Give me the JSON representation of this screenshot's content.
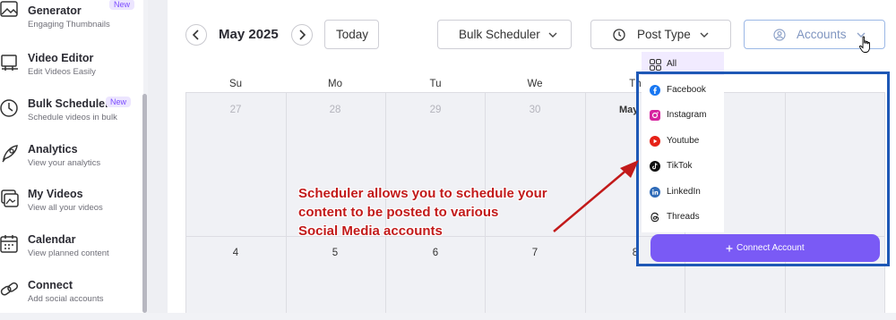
{
  "sidebar": {
    "items": [
      {
        "title": "Generator",
        "subtitle": "Engaging Thumbnails",
        "badge": "New",
        "icon": "image-icon"
      },
      {
        "title": "Video Editor",
        "subtitle": "Edit Videos Easily",
        "icon": "video-editor-icon"
      },
      {
        "title": "Bulk Scheduler",
        "subtitle": "Schedule videos in bulk",
        "badge": "New",
        "icon": "clock-icon"
      },
      {
        "title": "Analytics",
        "subtitle": "View your analytics",
        "icon": "rocket-icon"
      },
      {
        "title": "My Videos",
        "subtitle": "View all your videos",
        "icon": "my-videos-icon"
      },
      {
        "title": "Calendar",
        "subtitle": "View planned content",
        "icon": "calendar-icon"
      },
      {
        "title": "Connect",
        "subtitle": "Add social accounts",
        "icon": "link-icon"
      }
    ]
  },
  "toolbar": {
    "month_label": "May 2025",
    "today_label": "Today",
    "bulk_label": "Bulk Scheduler",
    "post_type_label": "Post Type",
    "accounts_label": "Accounts"
  },
  "calendar": {
    "weekdays": [
      "Su",
      "Mo",
      "Tu",
      "We",
      "Th"
    ],
    "row1": [
      "27",
      "28",
      "29",
      "30"
    ],
    "row1_may": "May",
    "row2": [
      "4",
      "5",
      "6",
      "7",
      "8"
    ]
  },
  "accounts_menu": {
    "items": [
      "All",
      "Facebook",
      "Instagram",
      "Youtube",
      "TikTok",
      "LinkedIn",
      "Threads"
    ],
    "connect_label": "Connect Account"
  },
  "annotation": {
    "lines": [
      "Scheduler allows you to schedule your",
      "content to be posted to various",
      "Social Media accounts"
    ]
  },
  "colors": {
    "accent": "#7a5af5",
    "highlight_box": "#1e58b6",
    "annotation_text": "#c21a1a"
  }
}
